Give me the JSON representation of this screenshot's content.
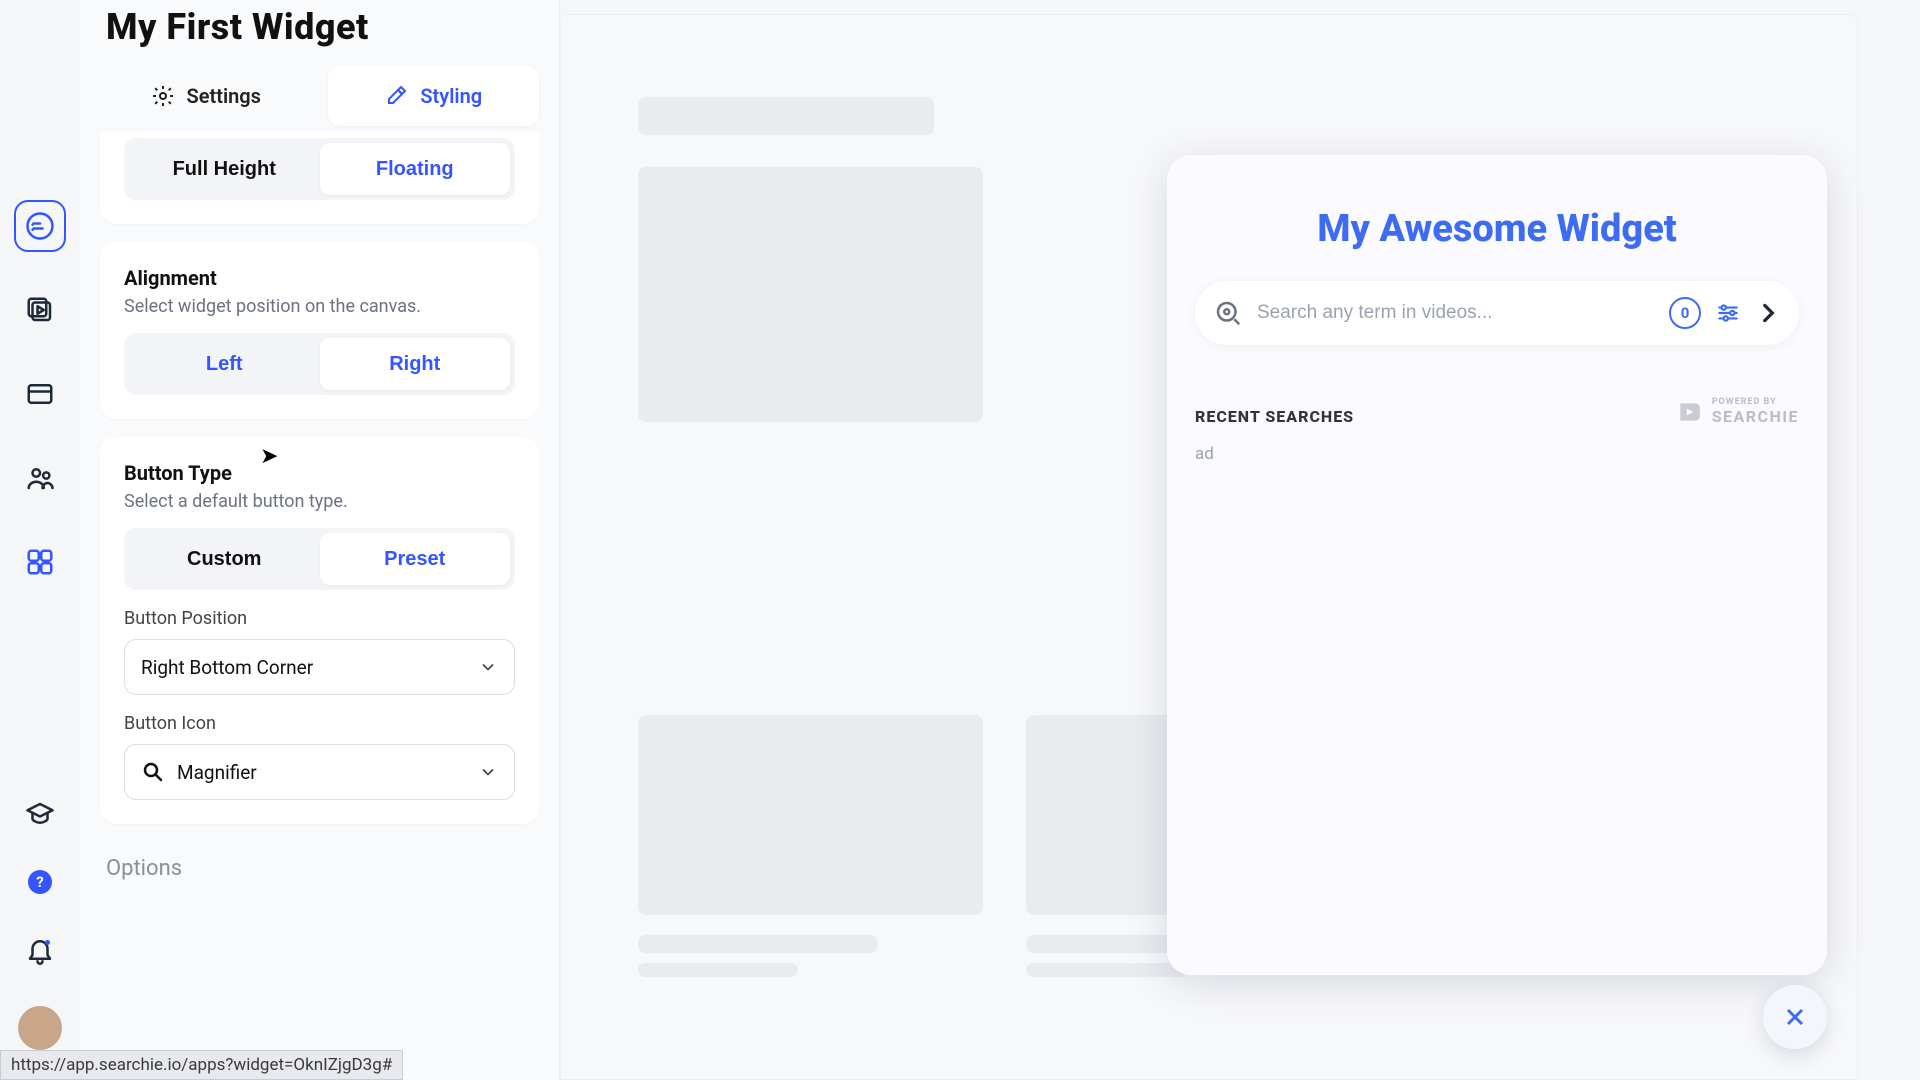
{
  "colors": {
    "accent": "#3455ff",
    "widget_accent": "#3d6cf2"
  },
  "sidebar": {
    "items": [
      "checklist",
      "media",
      "app-window",
      "users",
      "apps",
      "learn",
      "help",
      "notifications",
      "profile"
    ]
  },
  "panel": {
    "title": "My First Widget",
    "tabs": {
      "settings": "Settings",
      "styling": "Styling",
      "active": "styling"
    },
    "height": {
      "full": "Full Height",
      "floating": "Floating",
      "active": "floating"
    },
    "alignment": {
      "heading": "Alignment",
      "desc": "Select widget position on the canvas.",
      "left": "Left",
      "right": "Right",
      "active": "right"
    },
    "button_type": {
      "heading": "Button Type",
      "desc": "Select a default button type.",
      "custom": "Custom",
      "preset": "Preset",
      "active": "preset",
      "position_label": "Button Position",
      "position_value": "Right Bottom Corner",
      "icon_label": "Button Icon",
      "icon_value": "Magnifier"
    },
    "options_heading": "Options"
  },
  "preview": {
    "widget_title": "My Awesome Widget",
    "search_placeholder": "Search any term in videos...",
    "badge_count": "0",
    "recent_heading": "RECENT SEARCHES",
    "recent_items": [
      "ad"
    ],
    "powered_small": "POWERED BY",
    "powered_brand": "SEARCHIE"
  },
  "status_url": "https://app.searchie.io/apps?widget=OknIZjgD3g#"
}
